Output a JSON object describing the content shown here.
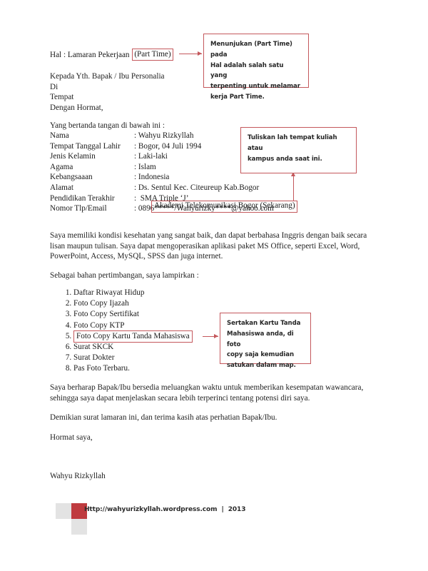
{
  "document": {
    "subject": {
      "label": "Hal : Lamaran Pekerjaan ",
      "highlight": "(Part Time)"
    },
    "recipient_lines": "Kepada Yth. Bapak / Ibu Personalia\nDi\nTempat\nDengan Hormat,",
    "intro": "Yang bertanda tangan di bawah ini :",
    "personal_data": [
      {
        "key": "Nama",
        "value": ": Wahyu Rizkyllah"
      },
      {
        "key": "Tempat Tanggal Lahir",
        "value": ": Bogor, 04 Juli 1994"
      },
      {
        "key": "Jenis Kelamin",
        "value": ": Laki-laki"
      },
      {
        "key": "Agama",
        "value": ": Islam"
      },
      {
        "key": "Kebangsaaan",
        "value": ": Indonesia"
      },
      {
        "key": "Alamat",
        "value": ": Ds. Sentul Kec. Citeureup Kab.Bogor"
      },
      {
        "key": "Pendidikan Terakhir",
        "value": ":  SMA Triple ‘J’"
      },
      {
        "key": "",
        "value": ""
      },
      {
        "key": "Nomor Tlp/Email",
        "value": ": 0896*****/Wahyurizky****@yahoo.com"
      }
    ],
    "education_boxed": "Akademi Telekomunikasi Bogor (Sekarang)",
    "paragraph_skills": "Saya memiliki kondisi kesehatan yang sangat baik, dan dapat berbahasa Inggris dengan baik secara lisan maupun tulisan. Saya dapat mengoperasikan aplikasi paket MS Office, seperti Excel, Word, PowerPoint, Access, MySQL, SPSS dan juga internet.",
    "paragraph_attachments_lead": "Sebagai bahan pertimbangan, saya lampirkan :",
    "attachments": [
      {
        "text": "Daftar Riwayat Hidup",
        "boxed": false
      },
      {
        "text": "Foto Copy Ijazah",
        "boxed": false
      },
      {
        "text": "Foto Copy Sertifikat",
        "boxed": false
      },
      {
        "text": "Foto Copy KTP",
        "boxed": false
      },
      {
        "text": "Foto Copy Kartu Tanda Mahasiswa",
        "boxed": true
      },
      {
        "text": "Surat SKCK",
        "boxed": false
      },
      {
        "text": "Surat Dokter",
        "boxed": false
      },
      {
        "text": "Pas Foto Terbaru.",
        "boxed": false
      }
    ],
    "paragraph_interview": "Saya berharap Bapak/Ibu bersedia meluangkan waktu untuk memberikan kesempatan wawancara, sehingga saya dapat menjelaskan secara lebih terperinci tentang potensi diri saya.",
    "paragraph_closing": "Demikian surat lamaran ini, dan terima kasih atas perhatian Bapak/Ibu.",
    "sign_off": "Hormat saya,",
    "signature_name": "Wahyu Rizkyllah"
  },
  "annotations": [
    {
      "id": "annotation-part-time",
      "text": "Menunjukan (Part Time) pada\nHal adalah salah satu yang\nterpenting untuk melamar\nkerja Part Time."
    },
    {
      "id": "annotation-campus",
      "text": "Tuliskan lah tempat kuliah atau\nkampus anda saat ini."
    },
    {
      "id": "annotation-student-card",
      "text": "Sertakan Kartu Tanda\nMahasiswa anda, di foto\ncopy saja kemudian\nsatukan dalam map."
    }
  ],
  "footer": {
    "text": "Http://wahyurizkyllah.wordpress.com  |  2013"
  },
  "colors": {
    "annotation_border": "#c4585c",
    "logo_red": "#bf3b3f",
    "logo_gray": "#e3e3e3",
    "body_text": "#1f1f1f"
  }
}
